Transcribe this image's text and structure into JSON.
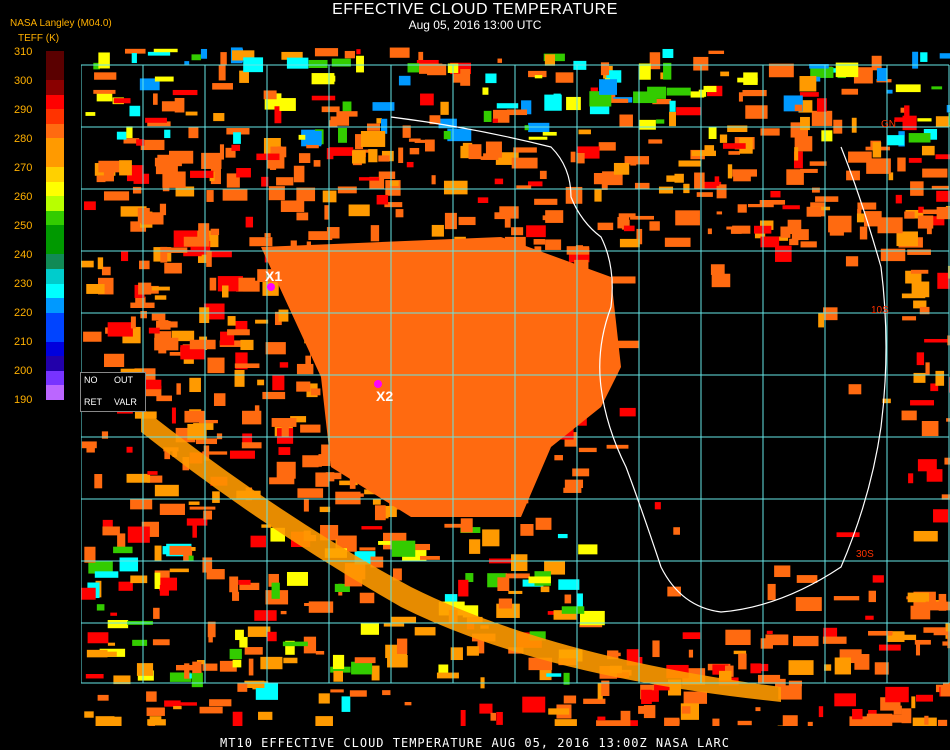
{
  "header": {
    "title": "EFFECTIVE CLOUD TEMPERATURE",
    "datetime": "Aug 05, 2016 13:00 UTC",
    "organization": "NASA Langley (M04.0)",
    "units": "TEFF (K)"
  },
  "colorbar": {
    "ticks": [
      "310",
      "300",
      "290",
      "280",
      "270",
      "260",
      "250",
      "240",
      "230",
      "220",
      "210",
      "200",
      "190"
    ],
    "colors": [
      "#5a0000",
      "#8a0000",
      "#ff0000",
      "#ff3300",
      "#ff6a10",
      "#ff9a00",
      "#ffd000",
      "#ffff00",
      "#b8ff00",
      "#33cc00",
      "#009900",
      "#118a55",
      "#00cccc",
      "#00ffff",
      "#0099ff",
      "#0044ff",
      "#0000dd",
      "#2200aa",
      "#7733ff",
      "#bb66ff",
      "#ffffff",
      "#999999",
      "#cccccc",
      "#000000"
    ]
  },
  "legend_box": {
    "no": "NO",
    "out": "OUT",
    "ret": "RET",
    "valr": "VALR"
  },
  "markers": [
    {
      "label": "X1",
      "color": "#ff00ff"
    },
    {
      "label": "X2",
      "color": "#ff00ff"
    }
  ],
  "map_colors": {
    "background": "#000000",
    "warm": "#ff6a10",
    "hot": "#ff0000",
    "mid": "#ff9a00",
    "cold": "#00ffff",
    "grid": "#66e6e6",
    "coast": "#ffffff"
  },
  "map_labels": [
    "GN",
    "10S",
    "30S"
  ],
  "footer": {
    "text": "MT10  EFFECTIVE CLOUD TEMPERATURE   AUG 05, 2016 13:00Z   NASA LARC"
  }
}
